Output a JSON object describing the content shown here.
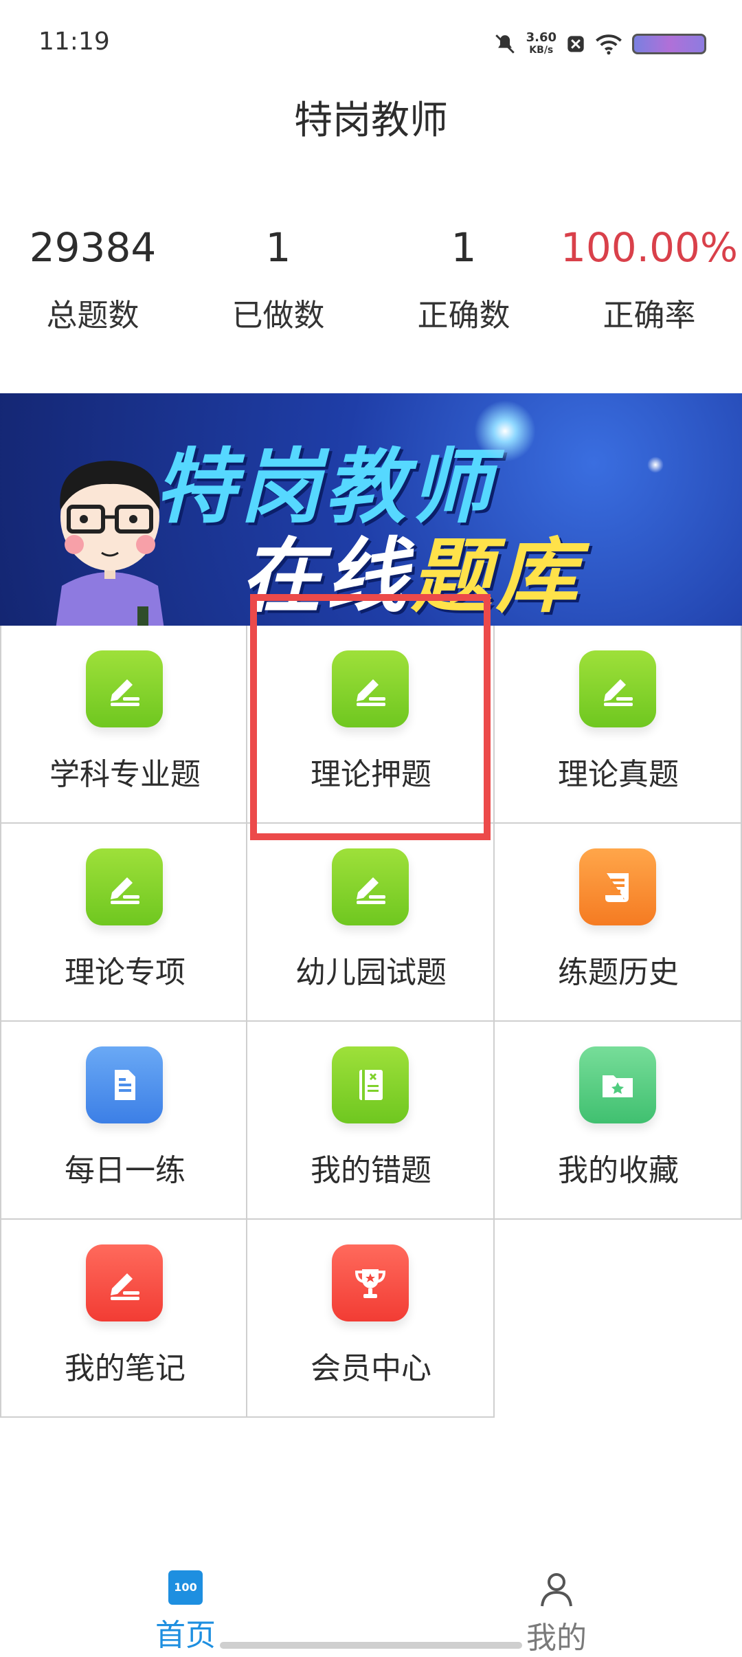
{
  "status_bar": {
    "time": "11:19",
    "speed_value": "3.60",
    "speed_unit": "KB/s"
  },
  "header": {
    "title": "特岗教师"
  },
  "stats": [
    {
      "value": "29384",
      "label": "总题数"
    },
    {
      "value": "1",
      "label": "已做数"
    },
    {
      "value": "1",
      "label": "正确数"
    },
    {
      "value": "100.00%",
      "label": "正确率",
      "color": "#d9404a"
    }
  ],
  "banner": {
    "line1": "特岗教师",
    "line2_part1": "在线",
    "line2_part2": "题库"
  },
  "grid": {
    "items": [
      {
        "label": "学科专业题",
        "icon": "pencil-icon",
        "color": "#7fd12b"
      },
      {
        "label": "理论押题",
        "icon": "pencil-icon",
        "color": "#7fd12b",
        "highlighted": true
      },
      {
        "label": "理论真题",
        "icon": "pencil-icon",
        "color": "#7fd12b"
      },
      {
        "label": "理论专项",
        "icon": "pencil-icon",
        "color": "#7fd12b"
      },
      {
        "label": "幼儿园试题",
        "icon": "pencil-icon",
        "color": "#7fd12b"
      },
      {
        "label": "练题历史",
        "icon": "scroll-icon",
        "color": "#f98c2f"
      },
      {
        "label": "每日一练",
        "icon": "document-icon",
        "color": "#4b8eeb"
      },
      {
        "label": "我的错题",
        "icon": "notebook-icon",
        "color": "#7fd12b"
      },
      {
        "label": "我的收藏",
        "icon": "star-folder-icon",
        "color": "#4fcc7e"
      },
      {
        "label": "我的笔记",
        "icon": "note-pencil-icon",
        "color": "#f5463c"
      },
      {
        "label": "会员中心",
        "icon": "trophy-icon",
        "color": "#f5463c"
      }
    ]
  },
  "bottom_nav": {
    "home_label": "首页",
    "home_icon_text": "100",
    "mine_label": "我的"
  },
  "colors": {
    "accent": "#1e8fe0",
    "highlight_box": "#ec4a4a"
  }
}
